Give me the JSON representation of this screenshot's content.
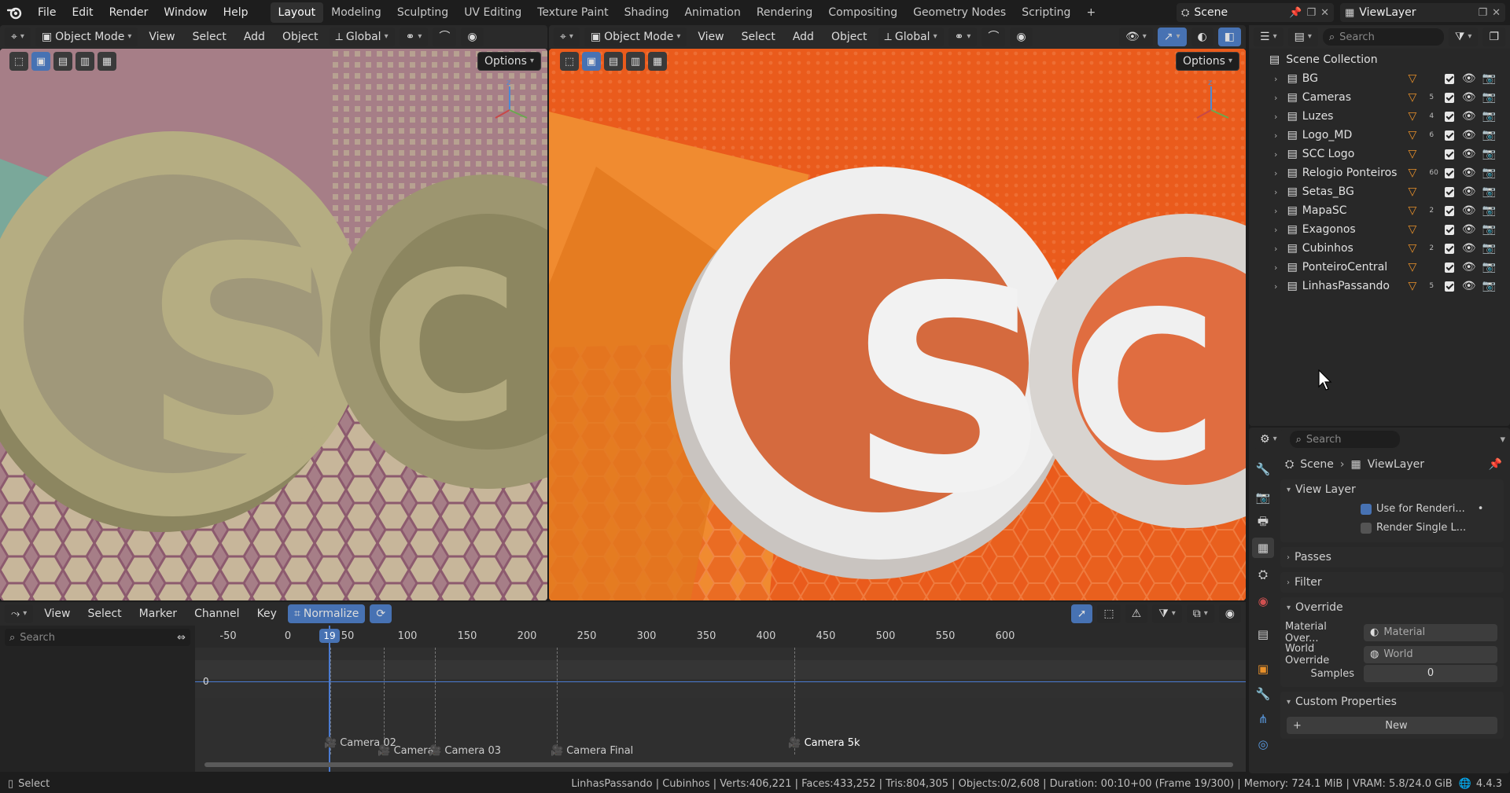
{
  "menus": [
    "File",
    "Edit",
    "Render",
    "Window",
    "Help"
  ],
  "workspaces": [
    "Layout",
    "Modeling",
    "Sculpting",
    "UV Editing",
    "Texture Paint",
    "Shading",
    "Animation",
    "Rendering",
    "Compositing",
    "Geometry Nodes",
    "Scripting"
  ],
  "active_workspace": "Layout",
  "scene_name": "Scene",
  "view_layer_name": "ViewLayer",
  "viewport_left": {
    "mode": "Object Mode",
    "menus": [
      "View",
      "Select",
      "Add",
      "Object"
    ],
    "orientation": "Global",
    "options_label": "Options",
    "logo_text": "SCC",
    "bg_color": "#a47f86",
    "logo_color": "#b5ad82"
  },
  "viewport_right": {
    "mode": "Object Mode",
    "menus": [
      "View",
      "Select",
      "Add",
      "Object"
    ],
    "orientation": "Global",
    "options_label": "Options",
    "logo_text": "SCC",
    "bg_color": "#e85a1c",
    "logo_color": "#e8e8e8"
  },
  "outliner": {
    "search_placeholder": "Search",
    "root": "Scene Collection",
    "collections": [
      {
        "name": "BG",
        "badge": ""
      },
      {
        "name": "Cameras",
        "badge": "5"
      },
      {
        "name": "Luzes",
        "badge": "4"
      },
      {
        "name": "Logo_MD",
        "badge": "6"
      },
      {
        "name": "SCC Logo",
        "badge": ""
      },
      {
        "name": "Relogio Ponteiros",
        "badge": "60"
      },
      {
        "name": "Setas_BG",
        "badge": ""
      },
      {
        "name": "MapaSC",
        "badge": "2"
      },
      {
        "name": "Exagonos",
        "badge": ""
      },
      {
        "name": "Cubinhos",
        "badge": "2"
      },
      {
        "name": "PonteiroCentral",
        "badge": ""
      },
      {
        "name": "LinhasPassando",
        "badge": "5"
      }
    ]
  },
  "properties": {
    "search_placeholder": "Search",
    "breadcrumb_scene": "Scene",
    "breadcrumb_layer": "ViewLayer",
    "view_layer_section": "View Layer",
    "use_for_rendering": "Use for Renderi...",
    "render_single": "Render Single L...",
    "passes": "Passes",
    "filter": "Filter",
    "override": "Override",
    "material_override_label": "Material Over...",
    "material_placeholder": "Material",
    "world_override_label": "World Override",
    "world_placeholder": "World",
    "samples_label": "Samples",
    "samples_value": "0",
    "custom_properties": "Custom Properties",
    "new_button": "New"
  },
  "timeline": {
    "menus": [
      "View",
      "Select",
      "Marker",
      "Channel",
      "Key"
    ],
    "normalize_label": "Normalize",
    "search_placeholder": "Search",
    "current_frame": "19",
    "ticks": [
      "-50",
      "0",
      "50",
      "100",
      "150",
      "200",
      "250",
      "300",
      "350",
      "400",
      "450",
      "500",
      "550",
      "600"
    ],
    "zero_label": "0",
    "markers": [
      "Camera 02",
      "Camera",
      "Camera 03",
      "Camera Final",
      "Camera 5k"
    ]
  },
  "status": {
    "left": "Select",
    "info": "LinhasPassando | Cubinhos | Verts:406,221 | Faces:433,252 | Tris:804,305 | Objects:0/2,608 | Duration: 00:10+00 (Frame 19/300) | Memory: 724.1 MiB | VRAM: 5.8/24.0 GiB",
    "version": "4.4.3"
  }
}
